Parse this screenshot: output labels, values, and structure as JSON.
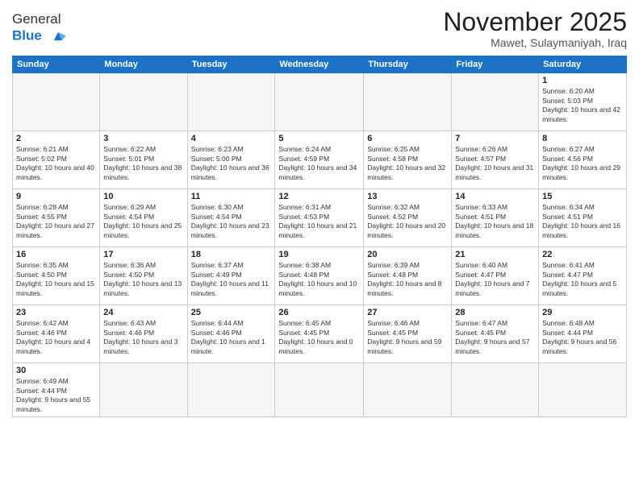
{
  "header": {
    "logo_general": "General",
    "logo_blue": "Blue",
    "month_title": "November 2025",
    "location": "Mawet, Sulaymaniyah, Iraq"
  },
  "weekdays": [
    "Sunday",
    "Monday",
    "Tuesday",
    "Wednesday",
    "Thursday",
    "Friday",
    "Saturday"
  ],
  "weeks": [
    [
      {
        "day": "",
        "info": ""
      },
      {
        "day": "",
        "info": ""
      },
      {
        "day": "",
        "info": ""
      },
      {
        "day": "",
        "info": ""
      },
      {
        "day": "",
        "info": ""
      },
      {
        "day": "",
        "info": ""
      },
      {
        "day": "1",
        "info": "Sunrise: 6:20 AM\nSunset: 5:03 PM\nDaylight: 10 hours and 42 minutes."
      }
    ],
    [
      {
        "day": "2",
        "info": "Sunrise: 6:21 AM\nSunset: 5:02 PM\nDaylight: 10 hours and 40 minutes."
      },
      {
        "day": "3",
        "info": "Sunrise: 6:22 AM\nSunset: 5:01 PM\nDaylight: 10 hours and 38 minutes."
      },
      {
        "day": "4",
        "info": "Sunrise: 6:23 AM\nSunset: 5:00 PM\nDaylight: 10 hours and 36 minutes."
      },
      {
        "day": "5",
        "info": "Sunrise: 6:24 AM\nSunset: 4:59 PM\nDaylight: 10 hours and 34 minutes."
      },
      {
        "day": "6",
        "info": "Sunrise: 6:25 AM\nSunset: 4:58 PM\nDaylight: 10 hours and 32 minutes."
      },
      {
        "day": "7",
        "info": "Sunrise: 6:26 AM\nSunset: 4:57 PM\nDaylight: 10 hours and 31 minutes."
      },
      {
        "day": "8",
        "info": "Sunrise: 6:27 AM\nSunset: 4:56 PM\nDaylight: 10 hours and 29 minutes."
      }
    ],
    [
      {
        "day": "9",
        "info": "Sunrise: 6:28 AM\nSunset: 4:55 PM\nDaylight: 10 hours and 27 minutes."
      },
      {
        "day": "10",
        "info": "Sunrise: 6:29 AM\nSunset: 4:54 PM\nDaylight: 10 hours and 25 minutes."
      },
      {
        "day": "11",
        "info": "Sunrise: 6:30 AM\nSunset: 4:54 PM\nDaylight: 10 hours and 23 minutes."
      },
      {
        "day": "12",
        "info": "Sunrise: 6:31 AM\nSunset: 4:53 PM\nDaylight: 10 hours and 21 minutes."
      },
      {
        "day": "13",
        "info": "Sunrise: 6:32 AM\nSunset: 4:52 PM\nDaylight: 10 hours and 20 minutes."
      },
      {
        "day": "14",
        "info": "Sunrise: 6:33 AM\nSunset: 4:51 PM\nDaylight: 10 hours and 18 minutes."
      },
      {
        "day": "15",
        "info": "Sunrise: 6:34 AM\nSunset: 4:51 PM\nDaylight: 10 hours and 16 minutes."
      }
    ],
    [
      {
        "day": "16",
        "info": "Sunrise: 6:35 AM\nSunset: 4:50 PM\nDaylight: 10 hours and 15 minutes."
      },
      {
        "day": "17",
        "info": "Sunrise: 6:36 AM\nSunset: 4:50 PM\nDaylight: 10 hours and 13 minutes."
      },
      {
        "day": "18",
        "info": "Sunrise: 6:37 AM\nSunset: 4:49 PM\nDaylight: 10 hours and 11 minutes."
      },
      {
        "day": "19",
        "info": "Sunrise: 6:38 AM\nSunset: 4:48 PM\nDaylight: 10 hours and 10 minutes."
      },
      {
        "day": "20",
        "info": "Sunrise: 6:39 AM\nSunset: 4:48 PM\nDaylight: 10 hours and 8 minutes."
      },
      {
        "day": "21",
        "info": "Sunrise: 6:40 AM\nSunset: 4:47 PM\nDaylight: 10 hours and 7 minutes."
      },
      {
        "day": "22",
        "info": "Sunrise: 6:41 AM\nSunset: 4:47 PM\nDaylight: 10 hours and 5 minutes."
      }
    ],
    [
      {
        "day": "23",
        "info": "Sunrise: 6:42 AM\nSunset: 4:46 PM\nDaylight: 10 hours and 4 minutes."
      },
      {
        "day": "24",
        "info": "Sunrise: 6:43 AM\nSunset: 4:46 PM\nDaylight: 10 hours and 3 minutes."
      },
      {
        "day": "25",
        "info": "Sunrise: 6:44 AM\nSunset: 4:46 PM\nDaylight: 10 hours and 1 minute."
      },
      {
        "day": "26",
        "info": "Sunrise: 6:45 AM\nSunset: 4:45 PM\nDaylight: 10 hours and 0 minutes."
      },
      {
        "day": "27",
        "info": "Sunrise: 6:46 AM\nSunset: 4:45 PM\nDaylight: 9 hours and 59 minutes."
      },
      {
        "day": "28",
        "info": "Sunrise: 6:47 AM\nSunset: 4:45 PM\nDaylight: 9 hours and 57 minutes."
      },
      {
        "day": "29",
        "info": "Sunrise: 6:48 AM\nSunset: 4:44 PM\nDaylight: 9 hours and 56 minutes."
      }
    ],
    [
      {
        "day": "30",
        "info": "Sunrise: 6:49 AM\nSunset: 4:44 PM\nDaylight: 9 hours and 55 minutes."
      },
      {
        "day": "",
        "info": ""
      },
      {
        "day": "",
        "info": ""
      },
      {
        "day": "",
        "info": ""
      },
      {
        "day": "",
        "info": ""
      },
      {
        "day": "",
        "info": ""
      },
      {
        "day": "",
        "info": ""
      }
    ]
  ]
}
